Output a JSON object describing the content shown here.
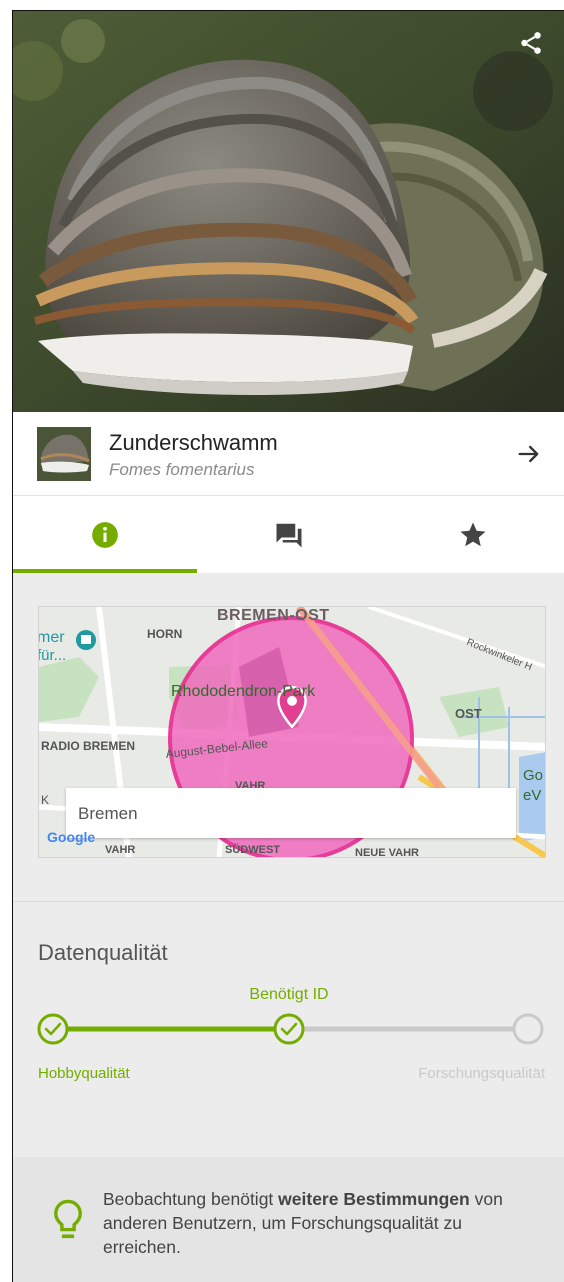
{
  "observation": {
    "common_name": "Zunderschwamm",
    "scientific_name": "Fomes fomentarius"
  },
  "icons": {
    "share": "share-icon",
    "arrow": "arrow-right-icon",
    "info_tab": "info-icon",
    "comments_tab": "comments-icon",
    "favorites_tab": "star-icon",
    "map_pin": "map-pin-icon",
    "lightbulb": "lightbulb-icon"
  },
  "map": {
    "place_name": "Bremen",
    "labels": {
      "bremen_ost": "BREMEN-OST",
      "horn": "HORN",
      "rockwinkeler": "Rockwinkeler H",
      "mer": "mer",
      "fuer": "für...",
      "rhododendron": "Rhododendron-Park",
      "ost": "OST",
      "radio_bremen": "RADIO BREMEN",
      "bebel": "August-Bebel-Allee",
      "vahr_top": "VAHR",
      "k": "K",
      "go": "Go",
      "ev": "eV",
      "google": "Google",
      "vahr": "VAHR",
      "suedwest": "SÜDWEST",
      "neue_vahr": "NEUE VAHR"
    },
    "accuracy_circle_color": "#f06bbd"
  },
  "data_quality": {
    "title": "Datenqualität",
    "current_level": "Benötigt ID",
    "level_left": "Hobbyqualität",
    "level_right": "Forschungsqualität",
    "progress_steps_completed": 2,
    "progress_steps_total": 3
  },
  "info": {
    "text_before": "Beobachtung benötigt ",
    "text_bold": "weitere Bestimmungen",
    "text_after": " von anderen Benutzern, um Forschungsqualität zu erreichen."
  },
  "colors": {
    "accent": "#74ac00",
    "inactive": "#c9c9c9"
  }
}
